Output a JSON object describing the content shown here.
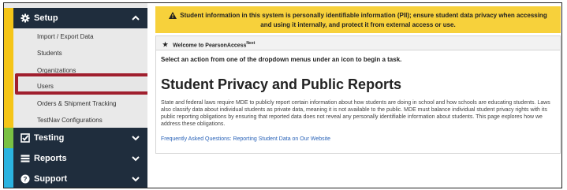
{
  "sidebar": {
    "setup": {
      "label": "Setup",
      "icon": "gear-icon",
      "stripe_color": "#f5c518",
      "expanded": true
    },
    "setup_items": [
      {
        "label": "Import / Export Data"
      },
      {
        "label": "Students"
      },
      {
        "label": "Organizations"
      },
      {
        "label": "Users",
        "highlighted": true
      },
      {
        "label": "Orders & Shipment Tracking"
      },
      {
        "label": "TestNav Configurations"
      }
    ],
    "testing": {
      "label": "Testing",
      "icon": "checkbox-icon",
      "stripe_color": "#7ac143"
    },
    "reports": {
      "label": "Reports",
      "icon": "list-icon",
      "stripe_color": "#2bb3e0"
    },
    "support": {
      "label": "Support",
      "icon": "question-icon",
      "stripe_color": "#2bb3e0"
    }
  },
  "banner": {
    "text": "Student information in this system is personally identifiable information (PII); ensure student data privacy when accessing and using it internally, and protect it from external access or use.",
    "color": "#f7d13b"
  },
  "card": {
    "welcome": "Welcome to PearsonAccess",
    "welcome_sup": "Next",
    "select_message": "Select an action from one of the dropdown menus under an icon to begin a task.",
    "title": "Student Privacy and Public Reports",
    "body": "State and federal laws require MDE to publicly report certain information about how students are doing in school and how schools are educating students. Laws also classify data about individual students as private data, meaning it is not available to the public. MDE must balance individual student privacy rights with its public reporting obligations by ensuring that reported data does not reveal any personally identifiable information about students. This page explores how we address these obligations.",
    "link": "Frequently Asked Questions: Reporting Student Data on Our Website"
  },
  "colors": {
    "nav_bg": "#1f2d3d",
    "highlight": "#a01f2e",
    "link": "#2a63b8"
  }
}
